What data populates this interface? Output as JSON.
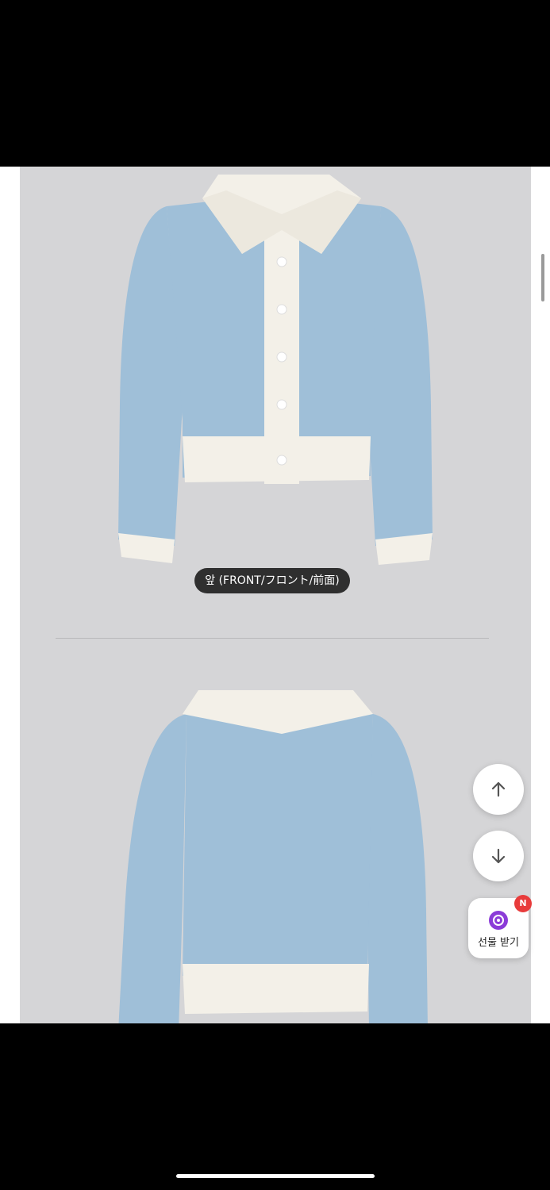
{
  "product_images": [
    {
      "caption": "앞 (FRONT/フロント/前面)",
      "alt": "front view"
    },
    {
      "caption": "",
      "alt": "back view"
    }
  ],
  "floating_actions": {
    "scroll_up_icon": "arrow-up",
    "scroll_down_icon": "arrow-down",
    "gift": {
      "label": "선물 받기",
      "badge": "N",
      "icon_color": "#8b3bd8"
    }
  },
  "colors": {
    "sweater_blue": "#9fbfd8",
    "trim_cream": "#f3f0e8",
    "panel_gray": "#d5d5d7"
  }
}
